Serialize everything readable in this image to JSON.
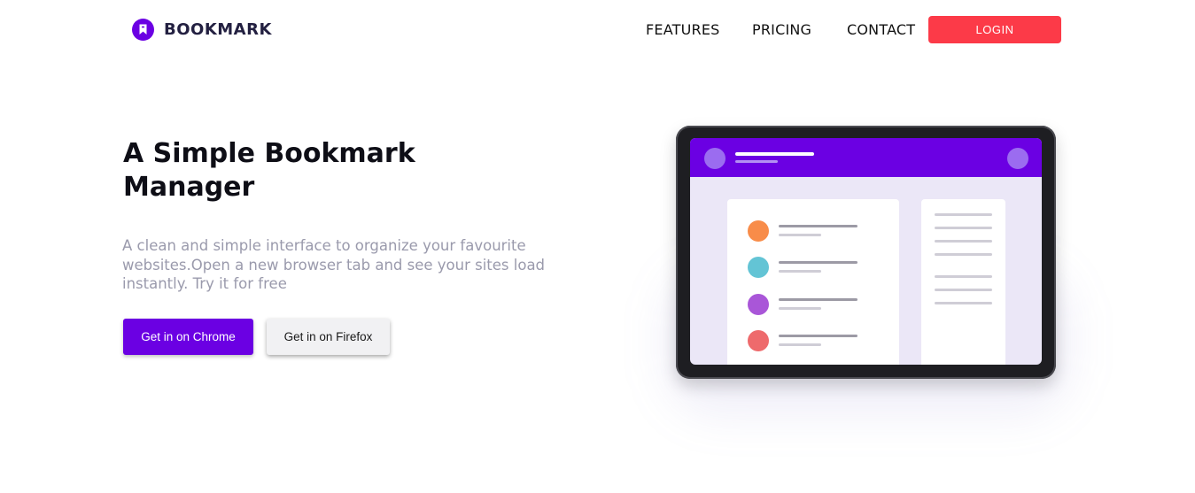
{
  "header": {
    "brand": "BOOKMARK",
    "nav": {
      "features": "FEATURES",
      "pricing": "PRICING",
      "contact": "CONTACT"
    },
    "login_label": "LOGIN"
  },
  "hero": {
    "title_line1": "A Simple Bookmark",
    "title_line2": "Manager",
    "description_line1": "A clean and simple interface to organize your favourite",
    "description_line2": "websites.Open a new browser tab and see your sites load",
    "description_line3": "instantly. Try it for free",
    "chrome_button": "Get in on Chrome",
    "firefox_button": "Get in on Firefox"
  },
  "illustration": {
    "icon": "tablet-bookmark-illustration",
    "list_dot_colors": [
      "#f88c49",
      "#63c4d5",
      "#a956d8",
      "#ee6a6c"
    ]
  },
  "colors": {
    "accent": "#6b00e3",
    "login": "#fc3a48",
    "text_muted": "#9a9aac"
  }
}
